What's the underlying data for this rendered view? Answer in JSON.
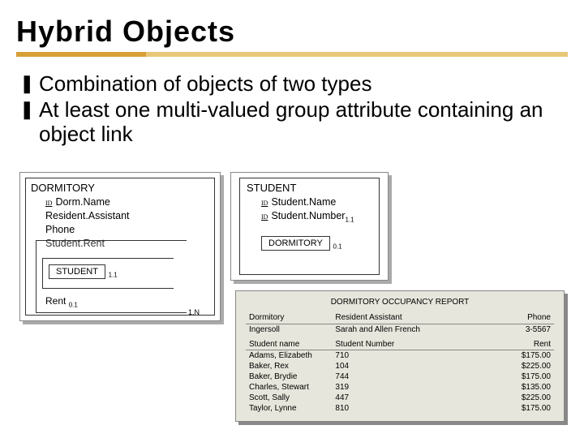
{
  "title": "Hybrid Objects",
  "bullets": [
    "Combination of objects of two types",
    "At least one multi-valued group attribute containing an object link"
  ],
  "dormitory": {
    "name": "DORMITORY",
    "attrs": {
      "dorm_name": "Dorm.Name",
      "resident_assistant": "Resident.Assistant",
      "phone": "Phone",
      "student_rent": "Student.Rent"
    },
    "link_label": "STUDENT",
    "link_card": "1.1",
    "rent_label": "Rent",
    "rent_card": "0.1",
    "outer_card": "1.N"
  },
  "student": {
    "name": "STUDENT",
    "attrs": {
      "student_name": "Student.Name",
      "student_number": "Student.Number"
    },
    "name_card": "1.1",
    "link_label": "DORMITORY",
    "link_card": "0.1"
  },
  "report": {
    "title": "DORMITORY OCCUPANCY REPORT",
    "headers": {
      "dormitory": "Dormitory",
      "ra": "Resident Assistant",
      "phone": "Phone"
    },
    "row": {
      "dormitory": "Ingersoll",
      "ra": "Sarah and Allen French",
      "phone": "3-5567"
    },
    "sub_headers": {
      "name": "Student name",
      "number": "Student Number",
      "rent": "Rent"
    },
    "students": [
      {
        "name": "Adams, Elizabeth",
        "number": "710",
        "rent": "$175.00"
      },
      {
        "name": "Baker, Rex",
        "number": "104",
        "rent": "$225.00"
      },
      {
        "name": "Baker, Brydie",
        "number": "744",
        "rent": "$175.00"
      },
      {
        "name": "Charles, Stewart",
        "number": "319",
        "rent": "$135.00"
      },
      {
        "name": "Scott, Sally",
        "number": "447",
        "rent": "$225.00"
      },
      {
        "name": "Taylor, Lynne",
        "number": "810",
        "rent": "$175.00"
      }
    ]
  }
}
